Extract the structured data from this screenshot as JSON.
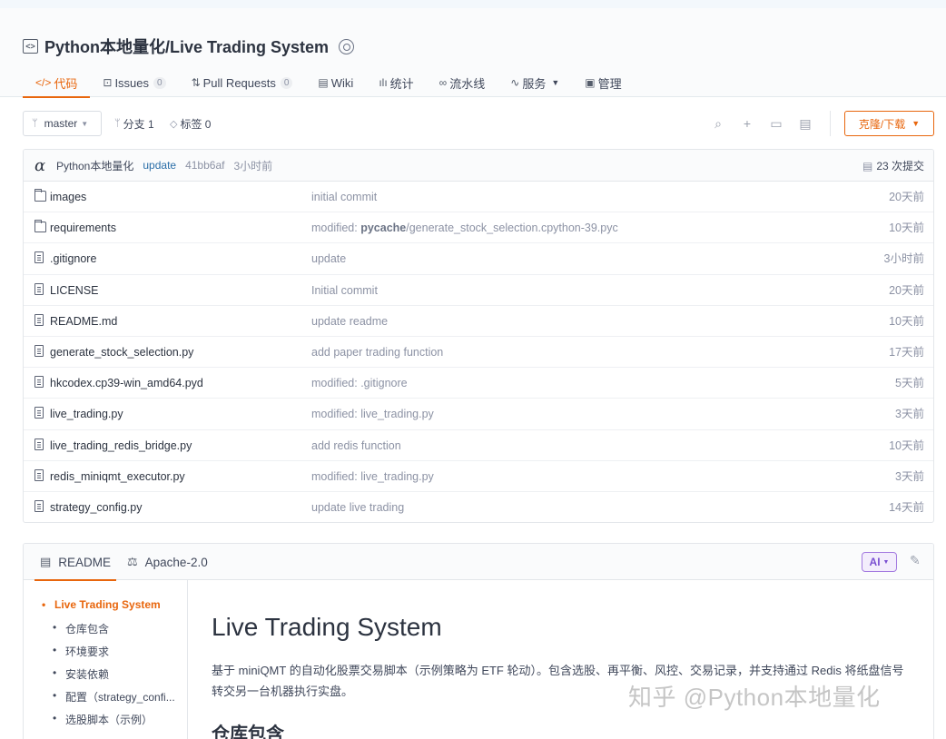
{
  "repo": {
    "title": "Python本地量化/Live Trading System"
  },
  "tabs": [
    {
      "label": "代码",
      "icon": "</>",
      "count": ""
    },
    {
      "label": "Issues",
      "icon": "⊡",
      "count": "0"
    },
    {
      "label": "Pull Requests",
      "icon": "⇅",
      "count": "0"
    },
    {
      "label": "Wiki",
      "icon": "▤",
      "count": ""
    },
    {
      "label": "统计",
      "icon": "ılı",
      "count": ""
    },
    {
      "label": "流水线",
      "icon": "∞",
      "count": ""
    },
    {
      "label": "服务",
      "icon": "∿",
      "count": ""
    },
    {
      "label": "管理",
      "icon": "▣",
      "count": ""
    }
  ],
  "branchbar": {
    "branch": "master",
    "branches": "分支 1",
    "tags": "标签 0",
    "clone": "克隆/下载"
  },
  "commit": {
    "author": "Python本地量化",
    "message": "update",
    "hash": "41bb6af",
    "time": "3小时前",
    "count": "23 次提交"
  },
  "files": [
    {
      "name": "images",
      "type": "folder",
      "msg": "initial commit",
      "time": "20天前"
    },
    {
      "name": "requirements",
      "type": "folder",
      "msg_prefix": "modified: ",
      "msg_bold": "pycache",
      "msg": "/generate_stock_selection.cpython-39.pyc",
      "time": "10天前"
    },
    {
      "name": ".gitignore",
      "type": "file",
      "msg": "update",
      "time": "3小时前"
    },
    {
      "name": "LICENSE",
      "type": "file",
      "msg": "Initial commit",
      "time": "20天前"
    },
    {
      "name": "README.md",
      "type": "file",
      "msg": "update readme",
      "time": "10天前"
    },
    {
      "name": "generate_stock_selection.py",
      "type": "file",
      "msg": "add paper trading function",
      "time": "17天前"
    },
    {
      "name": "hkcodex.cp39-win_amd64.pyd",
      "type": "file",
      "msg": "modified: .gitignore",
      "time": "5天前"
    },
    {
      "name": "live_trading.py",
      "type": "file",
      "msg": "modified: live_trading.py",
      "time": "3天前"
    },
    {
      "name": "live_trading_redis_bridge.py",
      "type": "file",
      "msg": "add redis function",
      "time": "10天前"
    },
    {
      "name": "redis_miniqmt_executor.py",
      "type": "file",
      "msg": "modified: live_trading.py",
      "time": "3天前"
    },
    {
      "name": "strategy_config.py",
      "type": "file",
      "msg": "update live trading",
      "time": "14天前"
    }
  ],
  "readme": {
    "tab_readme": "README",
    "tab_license": "Apache-2.0",
    "ai": "AI",
    "toc": [
      "Live Trading System",
      "仓库包含",
      "环境要求",
      "安装依赖",
      "配置（strategy_confi...",
      "选股脚本（示例）"
    ],
    "h1": "Live Trading System",
    "paragraph": "基于 miniQMT 的自动化股票交易脚本（示例策略为 ETF 轮动）。包含选股、再平衡、风控、交易记录，并支持通过 Redis 将纸盘信号转交另一台机器执行实盘。",
    "h2": "仓库包含"
  },
  "watermark": "知乎 @Python本地量化",
  "colors": {
    "accent": "#e8660d",
    "link": "#2a6ea8",
    "muted": "#8c92a4",
    "ai": "#7a4fd1"
  }
}
